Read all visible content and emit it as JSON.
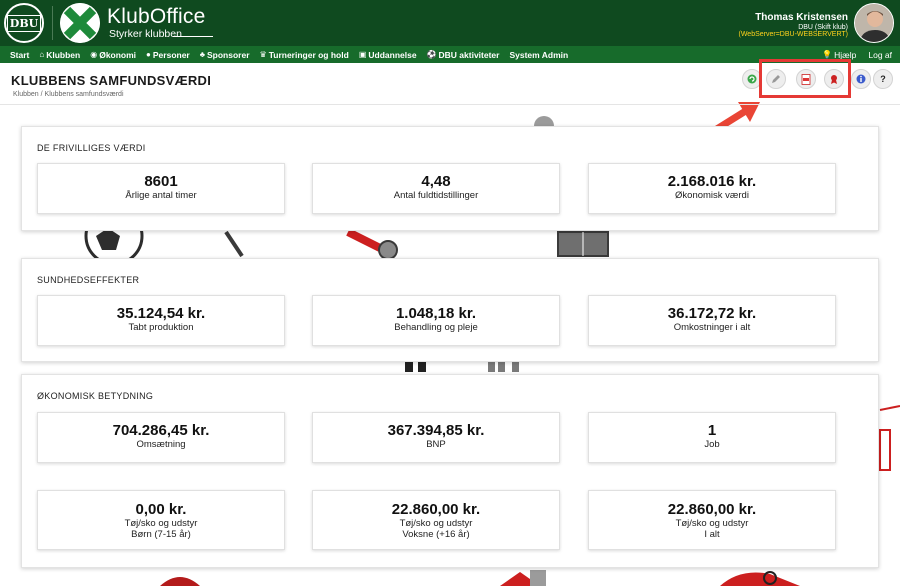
{
  "header": {
    "dbu_logo_text": "DBU",
    "brand_title": "KlubOffice",
    "brand_subtitle": "Styrker klubben",
    "user_name": "Thomas Kristensen",
    "user_club": "DBU (Skift klub)",
    "user_server": "(WebServer=DBU-WEBSERVERT)"
  },
  "nav": {
    "items": [
      {
        "label": "Start",
        "icon": ""
      },
      {
        "label": "Klubben",
        "icon": "home-icon"
      },
      {
        "label": "Økonomi",
        "icon": "coins-icon"
      },
      {
        "label": "Personer",
        "icon": "user-icon"
      },
      {
        "label": "Sponsorer",
        "icon": "users-icon"
      },
      {
        "label": "Turneringer og hold",
        "icon": "trophy-icon"
      },
      {
        "label": "Uddannelse",
        "icon": "education-icon"
      },
      {
        "label": "DBU aktiviteter",
        "icon": "ball-icon"
      },
      {
        "label": "System Admin",
        "icon": ""
      }
    ],
    "help_label": "Hjælp",
    "logout_label": "Log af"
  },
  "page": {
    "title": "KLUBBENS SAMFUNDSVÆRDI",
    "breadcrumb": "Klubben / Klubbens samfundsværdi"
  },
  "toolbar": {
    "buttons": [
      "refresh-icon",
      "pencil-icon",
      "pdf-icon",
      "badge-icon",
      "info-icon",
      "help-icon"
    ],
    "help_label": "?"
  },
  "sections": {
    "frivillige": {
      "title": "DE FRIVILLIGES VÆRDI",
      "cards": [
        {
          "value": "8601",
          "label": "Årlige antal timer"
        },
        {
          "value": "4,48",
          "label": "Antal fuldtidstillinger"
        },
        {
          "value": "2.168.016 kr.",
          "label": "Økonomisk værdi"
        }
      ]
    },
    "sundhed": {
      "title": "SUNDHEDSEFFEKTER",
      "cards": [
        {
          "value": "35.124,54 kr.",
          "label": "Tabt produktion"
        },
        {
          "value": "1.048,18 kr.",
          "label": "Behandling og pleje"
        },
        {
          "value": "36.172,72 kr.",
          "label": "Omkostninger i alt"
        }
      ]
    },
    "okonomisk": {
      "title": "ØKONOMISK BETYDNING",
      "cards": [
        {
          "value": "704.286,45 kr.",
          "label": "Omsætning"
        },
        {
          "value": "367.394,85 kr.",
          "label": "BNP"
        },
        {
          "value": "1",
          "label": "Job"
        }
      ],
      "cards2": [
        {
          "value": "0,00 kr.",
          "label": "Tøj/sko og udstyr",
          "label2": "Børn (7-15 år)"
        },
        {
          "value": "22.860,00 kr.",
          "label": "Tøj/sko og udstyr",
          "label2": "Voksne (+16 år)"
        },
        {
          "value": "22.860,00 kr.",
          "label": "Tøj/sko og udstyr",
          "label2": "I alt"
        }
      ]
    }
  },
  "colors": {
    "header_bg": "#0f4a1f",
    "nav_bg": "#176b2b",
    "accent_yellow": "#ffd21c",
    "highlight_red": "#e53935"
  }
}
